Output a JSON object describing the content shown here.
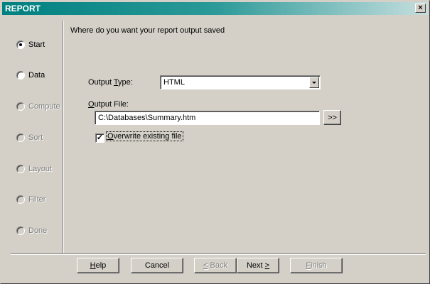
{
  "window": {
    "title": "REPORT",
    "close_glyph": "×"
  },
  "nav": {
    "items": [
      {
        "label": "Start",
        "selected": true,
        "enabled": true
      },
      {
        "label": "Data",
        "selected": false,
        "enabled": true
      },
      {
        "label": "Compute",
        "selected": false,
        "enabled": false
      },
      {
        "label": "Sort",
        "selected": false,
        "enabled": false
      },
      {
        "label": "Layout",
        "selected": false,
        "enabled": false
      },
      {
        "label": "Filter",
        "selected": false,
        "enabled": false
      },
      {
        "label": "Done",
        "selected": false,
        "enabled": false
      }
    ]
  },
  "main": {
    "prompt": "Where do you want your report output saved",
    "output_type": {
      "label_pre": "Output ",
      "label_u": "T",
      "label_post": "ype:",
      "value": "HTML"
    },
    "output_file": {
      "label_u": "O",
      "label_post": "utput File:",
      "value": "C:\\Databases\\Summary.htm",
      "browse_label": ">>"
    },
    "overwrite": {
      "label_u": "O",
      "label_post": "verwrite existing file",
      "checked": true,
      "check_glyph": "✓"
    }
  },
  "footer": {
    "help_u": "H",
    "help_post": "elp",
    "cancel": "Cancel",
    "back_u": "<",
    "back_post": " Back",
    "next_pre": "Next ",
    "next_u": ">",
    "finish_u": "F",
    "finish_post": "inish"
  }
}
